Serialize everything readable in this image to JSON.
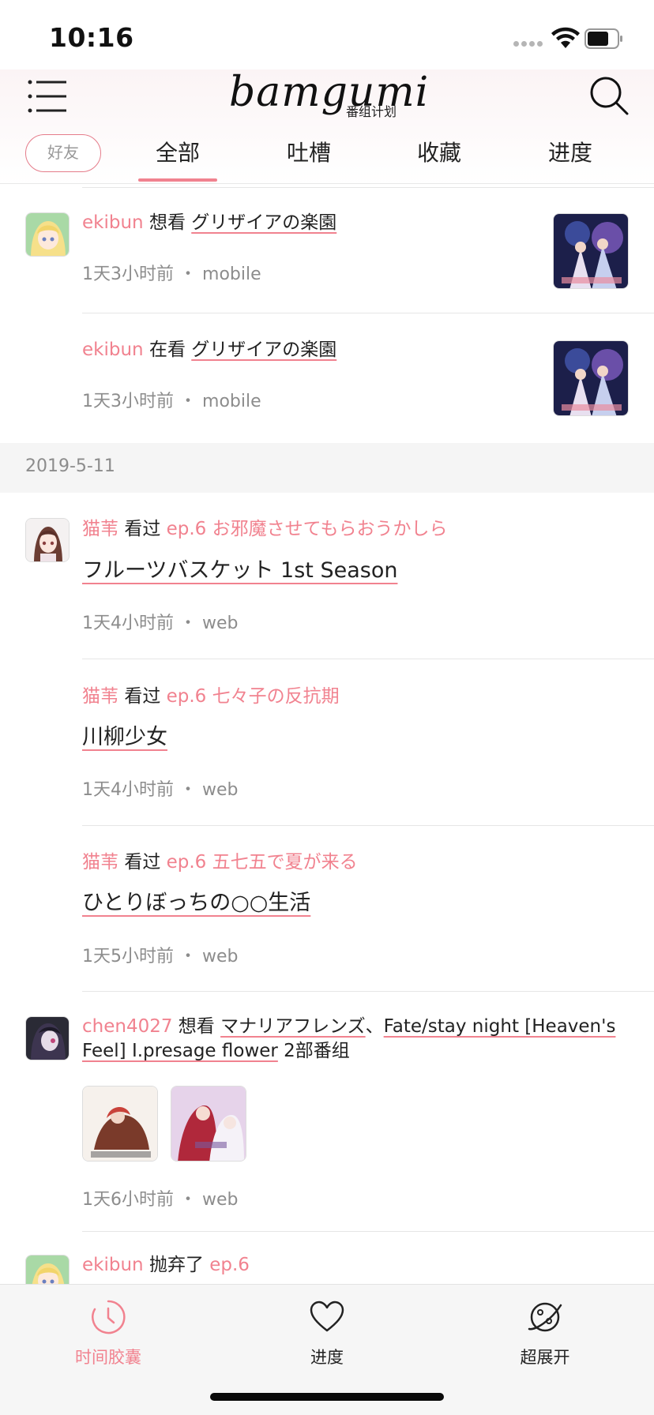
{
  "status_bar": {
    "time": "10:16"
  },
  "header": {
    "logo_text": "bamgumi",
    "logo_sub": "番组计划"
  },
  "tabs": {
    "friend": "好友",
    "items": [
      {
        "label": "全部",
        "active": true
      },
      {
        "label": "吐槽",
        "active": false
      },
      {
        "label": "收藏",
        "active": false
      },
      {
        "label": "进度",
        "active": false
      }
    ]
  },
  "feed": {
    "items": [
      {
        "user": "ekibun",
        "action": "想看",
        "subject": "グリザイアの楽園",
        "time": "1天3小时前",
        "source": "mobile"
      },
      {
        "user": "ekibun",
        "action": "在看",
        "subject": "グリザイアの楽園",
        "time": "1天3小时前",
        "source": "mobile"
      }
    ],
    "date_header": "2019-5-11",
    "watched": [
      {
        "user": "猫苇",
        "action": "看过",
        "ep": "ep.6 お邪魔させてもらおうかしら",
        "title": "フルーツバスケット 1st Season",
        "time": "1天4小时前",
        "source": "web"
      },
      {
        "user": "猫苇",
        "action": "看过",
        "ep": "ep.6 七々子の反抗期",
        "title": "川柳少女",
        "time": "1天4小时前",
        "source": "web"
      },
      {
        "user": "猫苇",
        "action": "看过",
        "ep": "ep.6 五七五で夏が来る",
        "title": "ひとりぼっちの○○生活",
        "time": "1天5小时前",
        "source": "web"
      }
    ],
    "multi": {
      "user": "chen4027",
      "action": "想看",
      "subject1": "マナリアフレンズ",
      "separator": "、",
      "subject2": "Fate/stay night [Heaven's Feel] I.presage flower",
      "count": "2部番组",
      "time": "1天6小时前",
      "source": "web"
    },
    "last": {
      "user": "ekibun",
      "action": "抛弃了",
      "ep": "ep.6"
    },
    "dot": "・"
  },
  "bottom_nav": {
    "items": [
      {
        "label": "时间胶囊",
        "icon": "clock-icon",
        "active": true
      },
      {
        "label": "进度",
        "icon": "heart-icon",
        "active": false
      },
      {
        "label": "超展开",
        "icon": "planet-icon",
        "active": false
      }
    ]
  },
  "colors": {
    "accent": "#f1828f",
    "meta": "#8c8c8c",
    "band": "#f5f5f5"
  }
}
